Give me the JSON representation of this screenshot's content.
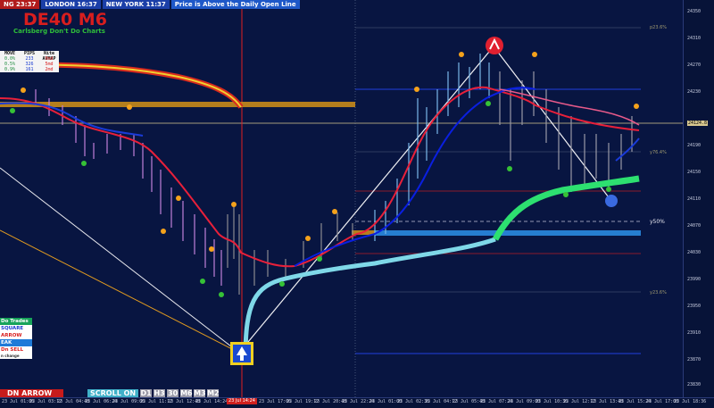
{
  "header": {
    "sessions": [
      {
        "label": "NG 23:37"
      },
      {
        "label": "LONDON  16:37"
      },
      {
        "label": "NEW YORK  11:37"
      }
    ],
    "message": "Price is Above the Daily Open Line"
  },
  "symbol_title": "DE40 M6",
  "subtitle": "Carlsberg Don't Do Charts",
  "stats_table": {
    "headers": [
      "MOVE",
      "PIPS",
      "Nite AVMAP"
    ],
    "rows": [
      [
        "0.0%",
        "233",
        "0md"
      ],
      [
        "0.5%",
        "326",
        "5md"
      ],
      [
        "0.9%",
        "161",
        "2md"
      ]
    ]
  },
  "panel": {
    "title": "Do Trades",
    "square": "SQUARE",
    "arrow": "ARROW",
    "peak": "EAK",
    "sell": "Dn SELL",
    "change": "n change"
  },
  "buttons": {
    "dn_arrow": "DN ARROW",
    "scroll": "SCROLL ON",
    "timeframes": [
      "D1",
      "H3",
      "30",
      "M6",
      "M3",
      "M2"
    ]
  },
  "levels": {
    "p23": "p23.6%",
    "l76": "y76.4%",
    "l50": "y50%",
    "l23": "y23.6%"
  },
  "price_axis": [
    "24350",
    "24310",
    "24270",
    "24230",
    "24190",
    "24150",
    "24110",
    "24070",
    "24030",
    "23990",
    "23950",
    "23910",
    "23870",
    "23830"
  ],
  "current_price": "24124.8",
  "time_axis": [
    "23 Jul 01:06",
    "23 Jul 03:12",
    "23 Jul 04:48",
    "23 Jul 06:24",
    "23 Jul 09:06",
    "23 Jul 11:12",
    "23 Jul 12:48",
    "23 Jul 14:24",
    "23 Jul 17:06",
    "23 Jul 19:12",
    "23 Jul 20:48",
    "23 Jul 22:24",
    "23 Jul 01:00",
    "23 Jul 02:36",
    "23 Jul 04:12",
    "23 Jul 05:48",
    "23 Jul 07:24",
    "23 Jul 09:00",
    "23 Jul 10:36",
    "23 Jul 12:12",
    "23 Jul 13:48",
    "23 Jul 15:24",
    "23 Jul 17:00",
    "23 Jul 18:36"
  ],
  "current_time_label": "23 Jul 14:24",
  "colors": {
    "background": "#081541",
    "red_ma": "#e8203a",
    "blue_ma": "#0a1fe0",
    "green_band": "#2de070",
    "cyan_band": "#7fd8e8",
    "orange_dot": "#f5a21b",
    "green_dot": "#36c236",
    "accent_red": "#d81e1e"
  }
}
